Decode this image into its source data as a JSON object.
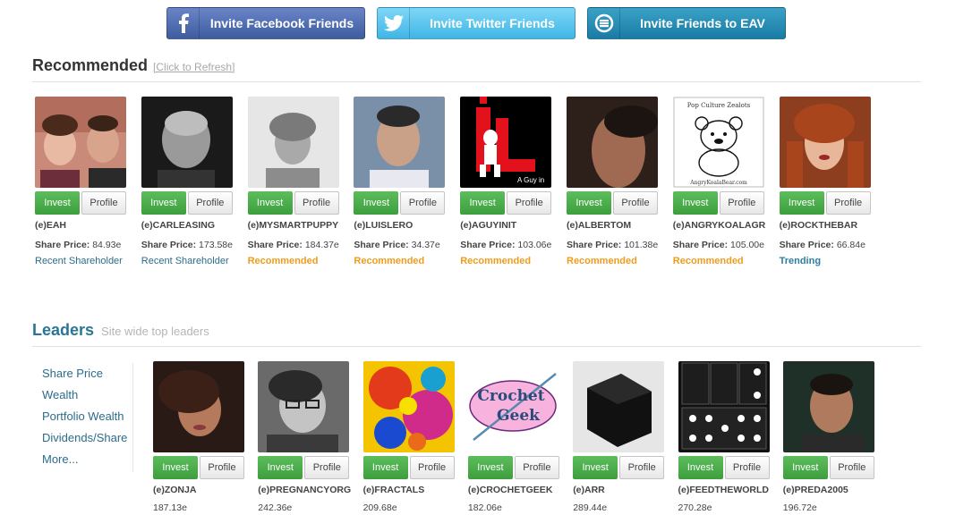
{
  "invite": {
    "facebook": "Invite Facebook Friends",
    "twitter": "Invite Twitter Friends",
    "eav": "Invite Friends to EAV"
  },
  "recommended": {
    "title": "Recommended",
    "refresh": "[Click to Refresh]",
    "cards": [
      {
        "user": "(e)EAH",
        "price_label": "Share Price:",
        "price": "84.93e",
        "tag": "Recent Shareholder",
        "tag_type": "shareholder"
      },
      {
        "user": "(e)CARLEASING",
        "price_label": "Share Price:",
        "price": "173.58e",
        "tag": "Recent Shareholder",
        "tag_type": "shareholder"
      },
      {
        "user": "(e)MYSMARTPUPPY",
        "price_label": "Share Price:",
        "price": "184.37e",
        "tag": "Recommended",
        "tag_type": "recommended"
      },
      {
        "user": "(e)LUISLERO",
        "price_label": "Share Price:",
        "price": "34.37e",
        "tag": "Recommended",
        "tag_type": "recommended"
      },
      {
        "user": "(e)AGUYINIT",
        "price_label": "Share Price:",
        "price": "103.06e",
        "tag": "Recommended",
        "tag_type": "recommended"
      },
      {
        "user": "(e)ALBERTOM",
        "price_label": "Share Price:",
        "price": "101.38e",
        "tag": "Recommended",
        "tag_type": "recommended"
      },
      {
        "user": "(e)ANGRYKOALAGR",
        "price_label": "Share Price:",
        "price": "105.00e",
        "tag": "Recommended",
        "tag_type": "recommended"
      },
      {
        "user": "(e)ROCKTHEBAR",
        "price_label": "Share Price:",
        "price": "66.84e",
        "tag": "Trending",
        "tag_type": "trending"
      }
    ]
  },
  "leaders": {
    "title": "Leaders",
    "subtitle": "Site wide top leaders",
    "menu": [
      "Share Price",
      "Wealth",
      "Portfolio Wealth",
      "Dividends/Share",
      "More..."
    ],
    "cards": [
      {
        "user": "(e)ZONJA",
        "price": "187.13e"
      },
      {
        "user": "(e)PREGNANCYORG",
        "price": "242.36e"
      },
      {
        "user": "(e)FRACTALS",
        "price": "209.68e"
      },
      {
        "user": "(e)CROCHETGEEK",
        "price": "182.06e"
      },
      {
        "user": "(e)ARR",
        "price": "289.44e"
      },
      {
        "user": "(e)FEEDTHEWORLD",
        "price": "270.28e"
      },
      {
        "user": "(e)PREDA2005",
        "price": "196.72e"
      }
    ]
  },
  "buttons": {
    "invest": "Invest",
    "profile": "Profile"
  },
  "photo_text": {
    "aguyinit_caption": "A Guy in",
    "koala_title": "Pop Culture Zealots",
    "koala_url": "AngryKoalaBear.com",
    "crochet_line1": "Crochet",
    "crochet_line2": "Geek"
  },
  "colors": {
    "invest_green": "#4cae4c",
    "link_blue": "#2a6d8c",
    "recommended_orange": "#f09c1a",
    "leaders_blue": "#2a7694"
  }
}
